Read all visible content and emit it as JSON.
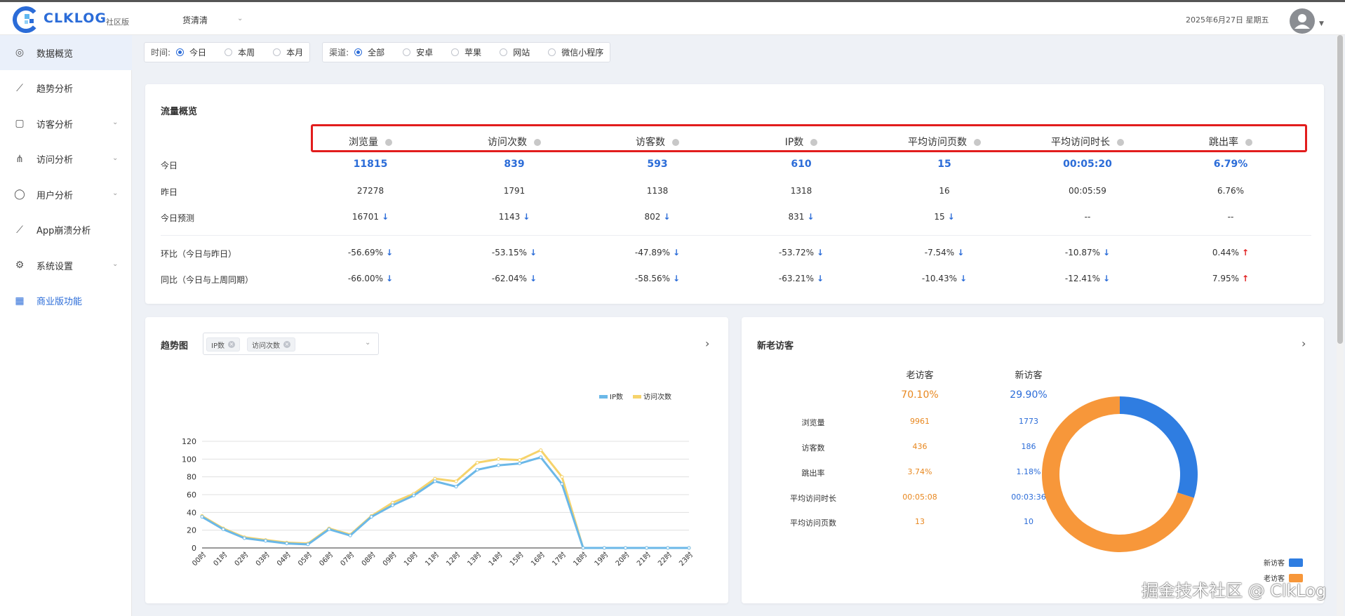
{
  "header": {
    "logo_text": "CLKLOG",
    "edition": "社区版",
    "project": "货清清",
    "date": "2025年6月27日 星期五"
  },
  "sidebar": {
    "items": [
      {
        "label": "数据概览",
        "icon": "dashboard-icon",
        "active": true,
        "expandable": false
      },
      {
        "label": "趋势分析",
        "icon": "trend-chart-icon",
        "active": false,
        "expandable": false
      },
      {
        "label": "访客分析",
        "icon": "visitor-icon",
        "active": false,
        "expandable": true
      },
      {
        "label": "访问分析",
        "icon": "hierarchy-icon",
        "active": false,
        "expandable": true
      },
      {
        "label": "用户分析",
        "icon": "user-icon",
        "active": false,
        "expandable": true
      },
      {
        "label": "App崩溃分析",
        "icon": "crash-chart-icon",
        "active": false,
        "expandable": false
      },
      {
        "label": "系统设置",
        "icon": "gear-icon",
        "active": false,
        "expandable": true
      },
      {
        "label": "商业版功能",
        "icon": "grid-icon",
        "active": false,
        "expandable": false
      }
    ]
  },
  "filters": {
    "time": {
      "label": "时间:",
      "options": [
        "今日",
        "本周",
        "本月"
      ],
      "selected": "今日"
    },
    "channel": {
      "label": "渠道:",
      "options": [
        "全部",
        "安卓",
        "苹果",
        "网站",
        "微信小程序"
      ],
      "selected": "全部"
    }
  },
  "overview": {
    "title": "流量概览",
    "columns": [
      "浏览量",
      "访问次数",
      "访客数",
      "IP数",
      "平均访问页数",
      "平均访问时长",
      "跳出率"
    ],
    "rows": [
      {
        "label": "今日",
        "values": [
          "11815",
          "839",
          "593",
          "610",
          "15",
          "00:05:20",
          "6.79%"
        ],
        "trend": [
          "",
          "",
          "",
          "",
          "",
          "",
          ""
        ]
      },
      {
        "label": "昨日",
        "values": [
          "27278",
          "1791",
          "1138",
          "1318",
          "16",
          "00:05:59",
          "6.76%"
        ],
        "trend": [
          "",
          "",
          "",
          "",
          "",
          "",
          ""
        ]
      },
      {
        "label": "今日预测",
        "values": [
          "16701",
          "1143",
          "802",
          "831",
          "15",
          "--",
          "--"
        ],
        "trend": [
          "down",
          "down",
          "down",
          "down",
          "down",
          "",
          ""
        ]
      },
      {
        "label": "环比（今日与昨日）",
        "values": [
          "-56.69%",
          "-53.15%",
          "-47.89%",
          "-53.72%",
          "-7.54%",
          "-10.87%",
          "0.44%"
        ],
        "trend": [
          "down",
          "down",
          "down",
          "down",
          "down",
          "down",
          "up"
        ]
      },
      {
        "label": "同比（今日与上周同期）",
        "values": [
          "-66.00%",
          "-62.04%",
          "-58.56%",
          "-63.21%",
          "-10.43%",
          "-12.41%",
          "7.95%"
        ],
        "trend": [
          "down",
          "down",
          "down",
          "down",
          "down",
          "down",
          "up"
        ]
      }
    ]
  },
  "trend": {
    "title": "趋势图",
    "tags": [
      "IP数",
      "访问次数"
    ]
  },
  "chart_data": {
    "type": "line",
    "title": "",
    "xlabel": "",
    "ylabel": "",
    "categories": [
      "00时",
      "01时",
      "02时",
      "03时",
      "04时",
      "05时",
      "06时",
      "07时",
      "08时",
      "09时",
      "10时",
      "11时",
      "12时",
      "13时",
      "14时",
      "15时",
      "16时",
      "17时",
      "18时",
      "19时",
      "20时",
      "21时",
      "22时",
      "23时"
    ],
    "series": [
      {
        "name": "IP数",
        "color": "#6bb8e8",
        "values": [
          35,
          21,
          11,
          8,
          5,
          4,
          21,
          14,
          35,
          48,
          59,
          75,
          69,
          88,
          93,
          95,
          102,
          72,
          0,
          0,
          0,
          0,
          0,
          0
        ]
      },
      {
        "name": "访问次数",
        "color": "#f6d36b",
        "values": [
          36,
          22,
          12,
          9,
          6,
          5,
          22,
          15,
          36,
          51,
          61,
          78,
          75,
          96,
          100,
          99,
          110,
          80,
          0,
          0,
          0,
          0,
          0,
          0
        ]
      }
    ],
    "ylim": [
      0,
      120
    ],
    "yticks": [
      0,
      20,
      40,
      60,
      80,
      100,
      120
    ],
    "grid": true,
    "legend": "top-right"
  },
  "visitors": {
    "title": "新老访客",
    "headers": [
      "老访客",
      "新访客"
    ],
    "percents": [
      "70.10%",
      "29.90%"
    ],
    "rows": [
      {
        "label": "浏览量",
        "old": "9961",
        "new": "1773"
      },
      {
        "label": "访客数",
        "old": "436",
        "new": "186"
      },
      {
        "label": "跳出率",
        "old": "3.74%",
        "new": "1.18%"
      },
      {
        "label": "平均访问时长",
        "old": "00:05:08",
        "new": "00:03:36"
      },
      {
        "label": "平均访问页数",
        "old": "13",
        "new": "10"
      }
    ],
    "donut": {
      "new_fraction": 0.299,
      "old_fraction": 0.701,
      "new_color": "#2f7de1",
      "old_color": "#f7973a"
    },
    "legend": [
      "新访客",
      "老访客"
    ]
  },
  "watermark": "掘金技术社区 @ ClkLog"
}
